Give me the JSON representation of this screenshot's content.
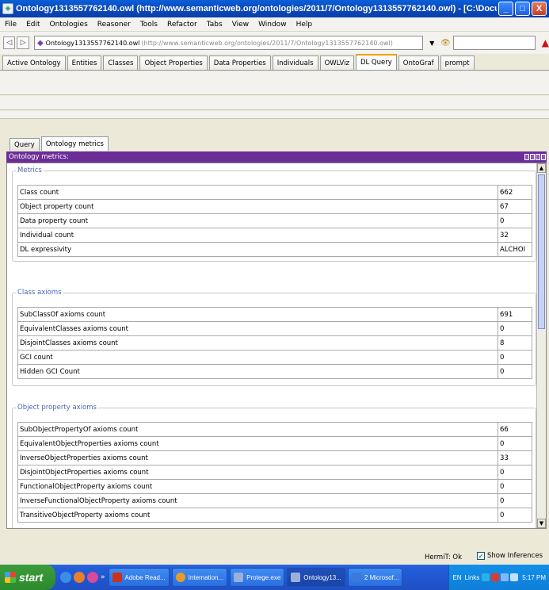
{
  "window": {
    "title": "Ontology1313557762140.owl (http://www.semanticweb.org/ontologies/2011/7/Ontology1313557762140.owl) - [C:\\Documents and Settings\\M. Te...",
    "min": "_",
    "max": "□",
    "close": "X"
  },
  "menu": [
    "File",
    "Edit",
    "Ontologies",
    "Reasoner",
    "Tools",
    "Refactor",
    "Tabs",
    "View",
    "Window",
    "Help"
  ],
  "address": {
    "ontology_name": "Ontology1313557762140.owl",
    "iri": "(http://www.semanticweb.org/ontologies/2011/7/Ontology1313557762140.owl)",
    "search_value": ""
  },
  "tabs": [
    {
      "label": "Active Ontology"
    },
    {
      "label": "Entities"
    },
    {
      "label": "Classes"
    },
    {
      "label": "Object Properties"
    },
    {
      "label": "Data Properties"
    },
    {
      "label": "Individuals"
    },
    {
      "label": "OWLViz"
    },
    {
      "label": "DL Query",
      "active": true
    },
    {
      "label": "OntoGraf"
    },
    {
      "label": "prompt"
    }
  ],
  "subtabs": [
    {
      "label": "Query"
    },
    {
      "label": "Ontology metrics",
      "active": true
    }
  ],
  "view": {
    "title": "Ontology metrics:"
  },
  "groups": {
    "metrics": {
      "legend": "Metrics",
      "rows": [
        {
          "name": "Class count",
          "value": "662"
        },
        {
          "name": "Object property count",
          "value": "67"
        },
        {
          "name": "Data property count",
          "value": "0"
        },
        {
          "name": "Individual count",
          "value": "32"
        },
        {
          "name": "DL expressivity",
          "value": "ALCHOI"
        }
      ]
    },
    "class_axioms": {
      "legend": "Class axioms",
      "rows": [
        {
          "name": "SubClassOf axioms count",
          "value": "691"
        },
        {
          "name": "EquivalentClasses axioms count",
          "value": "0"
        },
        {
          "name": "DisjointClasses axioms count",
          "value": "8"
        },
        {
          "name": "GCI count",
          "value": "0"
        },
        {
          "name": "Hidden GCI Count",
          "value": "0"
        }
      ]
    },
    "object_property_axioms": {
      "legend": "Object property axioms",
      "rows": [
        {
          "name": "SubObjectPropertyOf axioms count",
          "value": "66"
        },
        {
          "name": "EquivalentObjectProperties axioms count",
          "value": "0"
        },
        {
          "name": "InverseObjectProperties axioms count",
          "value": "33"
        },
        {
          "name": "DisjointObjectProperties axioms count",
          "value": "0"
        },
        {
          "name": "FunctionalObjectProperty axioms count",
          "value": "0"
        },
        {
          "name": "InverseFunctionalObjectProperty axioms count",
          "value": "0"
        },
        {
          "name": "TransitiveObjectProperty axioms count",
          "value": "0"
        }
      ]
    }
  },
  "status": {
    "reasoner": "HermiT: Ok",
    "show_inferences_label": "Show Inferences",
    "show_inferences_checked": true
  },
  "taskbar": {
    "start": "start",
    "buttons": [
      {
        "label": "Adobe Read...",
        "icon_color": "#c8321e"
      },
      {
        "label": "Internation...",
        "icon_color": "#e89a2a"
      },
      {
        "label": "Protege.exe",
        "icon_color": "#9ab0d8"
      },
      {
        "label": "Ontology13...",
        "icon_color": "#9ab0d8",
        "active": true
      },
      {
        "label": "2 Microsof...",
        "icon_color": "#3a7bd8"
      }
    ],
    "lang": "EN",
    "links": "Links",
    "time": "5:17 PM"
  }
}
